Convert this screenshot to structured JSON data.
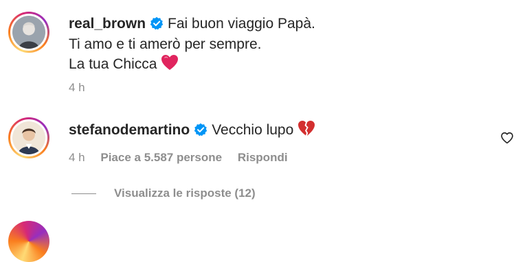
{
  "comments": [
    {
      "username": "real_brown",
      "verified": true,
      "lines": [
        "Fai buon viaggio Papà.",
        "Ti amo e ti amerò per sempre.",
        "La tua Chicca"
      ],
      "emoji": "red-heart",
      "time": "4 h"
    },
    {
      "username": "stefanodemartino",
      "verified": true,
      "text": "Vecchio lupo",
      "emoji": "broken-heart",
      "time": "4 h",
      "likes": "Piace a 5.587 persone",
      "reply_label": "Rispondi",
      "view_replies": "Visualizza le risposte (12)"
    }
  ],
  "colors": {
    "text": "#262626",
    "secondary": "#8e8e8e",
    "verified": "#0095f6",
    "heart": "#e0245e"
  }
}
